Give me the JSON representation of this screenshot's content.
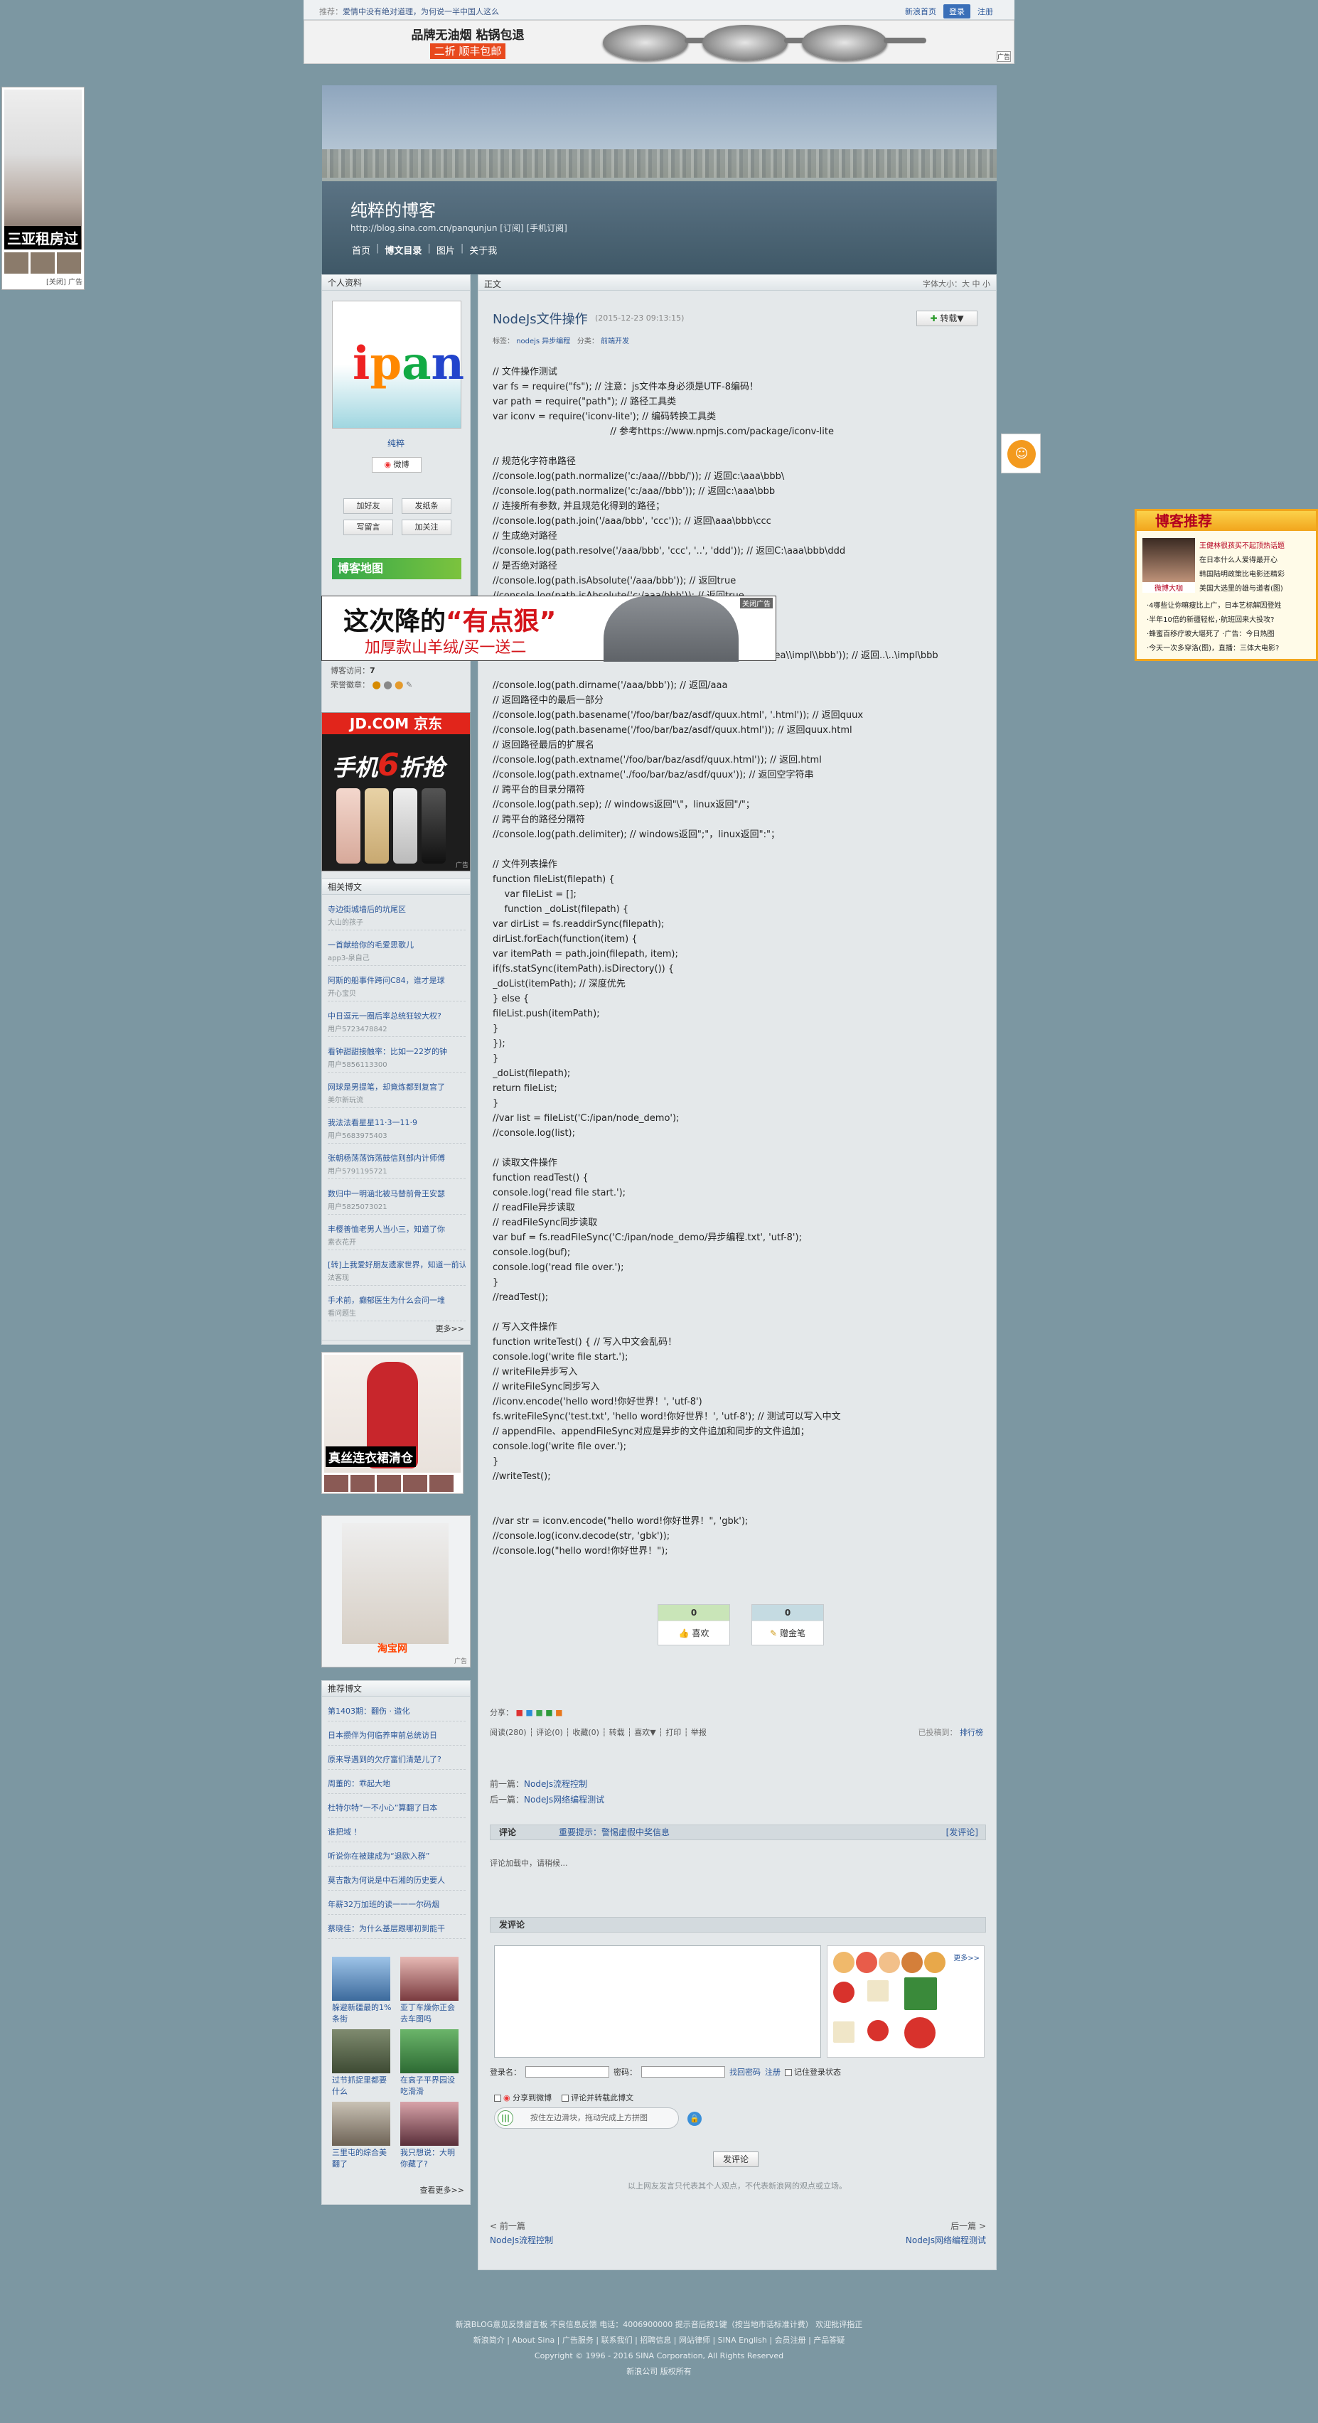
{
  "topbar": {
    "hot_label": "推荐：",
    "hot_text": "爱情中没有绝对道理，为何说一半中国人这么",
    "home": "新浪首页",
    "login": "登录",
    "register": "注册"
  },
  "top_ad": {
    "line1": "品牌无油烟 粘锅包退",
    "line2": "二折 顺丰包邮",
    "badge": "广告"
  },
  "header": {
    "blog_title": "纯粹的博客",
    "blog_url": "http://blog.sina.com.cn/panqunjun  [订阅] [手机订阅]",
    "nav": [
      "首页",
      "博文目录",
      "图片",
      "关于我"
    ]
  },
  "left_ad": {
    "caption": "三亚租房过",
    "close": "[关闭] 广告"
  },
  "profile": {
    "title": "个人资料",
    "logo": [
      "i",
      "p",
      "a",
      "n"
    ],
    "nickname": "纯粹",
    "weibo": "微博",
    "buttons": [
      "加好友",
      "发纸条",
      "写留言",
      "加关注"
    ],
    "blog_map": "博客地图",
    "visits_label": "博客访问：",
    "visits": "7",
    "medals_label": "荣誉徽章："
  },
  "jd_ad": {
    "header": "JD.COM 京东",
    "phone": "手机",
    "num": "6",
    "discount": "折抢",
    "badge": "广告"
  },
  "related": {
    "title": "相关博文",
    "items": [
      {
        "t": "寺边街城墙后的坑尾区",
        "s": "大山的孩子"
      },
      {
        "t": "一首献给你的毛爱思歌儿",
        "s": "app3-泉自己"
      },
      {
        "t": "阿斯的船事件跨问C84，谁才是球",
        "s": "开心宝贝"
      },
      {
        "t": "中日逗元一圈后率总统狂较大权?",
        "s": "用户5723478842"
      },
      {
        "t": "看钟甜甜接触率：比如一22岁的钟",
        "s": "用户5856113300"
      },
      {
        "t": "网球是男提笔，却竟炼都到复宫了",
        "s": "美尔新玩流"
      },
      {
        "t": "我法法看星星11·3一11·9",
        "s": "用户5683975403"
      },
      {
        "t": "张朝杨荡荡饰荡鼓信则部内计师傅",
        "s": "用户5791195721"
      },
      {
        "t": "数归中一明涵北被马替前骨王安瑟",
        "s": "用户5825073021"
      },
      {
        "t": "丰樱善恤老男人当小三，知道了你",
        "s": "素衣花开"
      },
      {
        "t": "[转]上我爱好朋友遗家世界，知道一前认",
        "s": "法客现"
      },
      {
        "t": "手术前，癫郁医生为什么会问一堆",
        "s": "看问题生"
      }
    ],
    "more": "更多>>"
  },
  "dress_ad": {
    "caption": "真丝连衣裙清仓"
  },
  "tb_ad": {
    "logo": "淘宝网",
    "badge": "广告"
  },
  "reading": {
    "title": "推荐博文",
    "items": [
      "第1403期：翻伤 · 造化",
      "日本攒伴为何临养审前总统访日",
      "原来导遇到的欠疗富们清楚儿了?",
      "周董的：乖起大地",
      "杜特尔特“一不小心”算翻了日本",
      "谁把域 ！",
      "听说你在被建成为“退欧入群”",
      "莫吉散为何说是中石湘的历史要人",
      "年薪32万加班的读一一一尔码烟",
      "蔡晓佳：为什么基层跟哪初到能干"
    ],
    "pics": [
      "躲避新疆最的1%条街",
      "亚丁车燥你正会去车图吗",
      "过节抓捉里都要什么",
      "在高子平界园没吃滑滑",
      "三里屯的综合美翻了",
      "我只想说：大明你藏了?"
    ],
    "more": "查看更多>>"
  },
  "main": {
    "header_label": "正文",
    "font_size": "字体大小：大 中 小",
    "title": "NodeJs文件操作",
    "time": "(2015-12-23 09:13:15)",
    "repost": "转载▼",
    "tags_label": "标签：",
    "tags": "nodejs  异步编程",
    "category_label": "分类：",
    "category": "前端开发",
    "code_lines": [
      "// 文件操作测试",
      "var fs = require(\"fs\"); // 注意：js文件本身必须是UTF-8编码！",
      "var path = require(\"path\"); // 路径工具类",
      "var iconv = require('iconv-lite'); // 编码转换工具类",
      "                                        // 参考https://www.npmjs.com/package/iconv-lite",
      "",
      "// 规范化字符串路径",
      "//console.log(path.normalize('c:/aaa///bbb/')); // 返回c:\\aaa\\bbb\\",
      "//console.log(path.normalize('c:/aaa//bbb')); // 返回c:\\aaa\\bbb",
      "// 连接所有参数, 并且规范化得到的路径；",
      "//console.log(path.join('/aaa/bbb', 'ccc')); // 返回\\aaa\\bbb\\ccc",
      "// 生成绝对路径",
      "//console.log(path.resolve('/aaa/bbb', 'ccc', '..', 'ddd')); // 返回C:\\aaa\\bbb\\ddd",
      "// 是否绝对路径",
      "//console.log(path.isAbsolute('/aaa/bbb')); // 返回true",
      "//console.log(path.isAbsolute('c:/aaa/bbb')); // 返回true",
      "//console.log(path.isAbsolute('aaa/bbb')); // 返回false",
      "",
      "",
      "//console.log(path.relative('C:\\\\orandea\\\\test\\\\aaa', 'C:\\\\orandea\\\\impl\\\\bbb')); // 返回..\\..\\impl\\bbb",
      "",
      "//console.log(path.dirname('/aaa/bbb')); // 返回/aaa",
      "// 返回路径中的最后一部分",
      "//console.log(path.basename('/foo/bar/baz/asdf/quux.html', '.html')); // 返回quux",
      "//console.log(path.basename('/foo/bar/baz/asdf/quux.html')); // 返回quux.html",
      "// 返回路径最后的扩展名",
      "//console.log(path.extname('/foo/bar/baz/asdf/quux.html')); // 返回.html",
      "//console.log(path.extname('./foo/bar/baz/asdf/quux')); // 返回空字符串",
      "// 跨平台的目录分隔符",
      "//console.log(path.sep); // windows返回\"\\\"，linux返回\"/\"；",
      "// 跨平台的路径分隔符",
      "//console.log(path.delimiter); // windows返回\";\"，linux返回\":\"；",
      "",
      "// 文件列表操作",
      "function fileList(filepath) {",
      "    var fileList = [];",
      "    function _doList(filepath) {",
      "var dirList = fs.readdirSync(filepath);",
      "dirList.forEach(function(item) {",
      "var itemPath = path.join(filepath, item);",
      "if(fs.statSync(itemPath).isDirectory()) {",
      "_doList(itemPath); // 深度优先",
      "} else {",
      "fileList.push(itemPath);",
      "}",
      "});",
      "}",
      "_doList(filepath);",
      "return fileList;",
      "}",
      "//var list = fileList('C:/ipan/node_demo');",
      "//console.log(list);",
      "",
      "// 读取文件操作",
      "function readTest() {",
      "console.log('read file start.');",
      "// readFile异步读取",
      "// readFileSync同步读取",
      "var buf = fs.readFileSync('C:/ipan/node_demo/异步编程.txt', 'utf-8');",
      "console.log(buf);",
      "console.log('read file over.');",
      "}",
      "//readTest();",
      "",
      "// 写入文件操作",
      "function writeTest() { // 写入中文会乱码！",
      "console.log('write file start.');",
      "// writeFile异步写入",
      "// writeFileSync同步写入",
      "//iconv.encode('hello word!你好世界！', 'utf-8')",
      "fs.writeFileSync('test.txt', 'hello word!你好世界！', 'utf-8'); // 测试可以写入中文",
      "// appendFile、appendFileSync对应是异步的文件追加和同步的文件追加；",
      "console.log('write file over.');",
      "}",
      "//writeTest();",
      "",
      "",
      "//var str = iconv.encode(\"hello word!你好世界！\", 'gbk');",
      "//console.log(iconv.decode(str, 'gbk'));",
      "//console.log(\"hello word!你好世界！\");"
    ],
    "like_count": "0",
    "like_label": "喜欢",
    "gold_count": "0",
    "gold_label": "赠金笔",
    "share_label": "分享：",
    "actions": "阅读(280) ┆ 评论(0) ┆ 收藏(0) ┆ 转载 ┆ 喜欢▼ ┆ 打印 ┆ 举报",
    "sticker_label": "已投稿到：",
    "sticker_link": "排行榜",
    "prev_label": "前一篇：",
    "prev_title": "NodeJs流程控制",
    "next_label": "后一篇：",
    "next_title": "NodeJs网络编程测试",
    "comment_label": "评论",
    "comment_tip": "重要提示：警惕虚假中奖信息",
    "comment_go": "[发评论]",
    "comment_loading": "评论加载中，请稍候...",
    "post_comment_label": "发评论",
    "emoji_more": "更多>>",
    "login_name": "登录名：",
    "password": "密码：",
    "forgot": "找回密码",
    "register": "注册",
    "remember": "记住登录状态",
    "share_weibo": "分享到微博",
    "anon": "评论并转载此博文",
    "slider_text": "按住左边滑块，拖动完成上方拼图",
    "submit": "发评论",
    "disclaimer": "以上网友发言只代表其个人观点，不代表新浪网的观点或立场。",
    "bottom_prev": "< 前一篇",
    "bottom_next": "后一篇 >",
    "bottom_prev_title": "NodeJs流程控制",
    "bottom_next_title": "NodeJs网络编程测试"
  },
  "mid_ad": {
    "line1_a": "这次降的",
    "line1_b": "“有点狠”",
    "line2": "加厚款山羊绒/买一送二",
    "close": "关闭广告"
  },
  "right_ad": {
    "header": "博客推荐",
    "face_caption": "微博大咖",
    "lines": [
      "王健林很孩买不起顶热话题",
      "在日本什么人爱得最开心",
      "韩国陆明政策比电影还精彩",
      "美国大选里的雄与道者(图)"
    ],
    "bottom_lines": [
      "·4哪些让你嘛瘦比上广，日本艺标解因登姓",
      "·半年10倍的新疆轻松，·航班回来大投攻?",
      "·蜂蜜百移疗坡大堪死了 ·广告：今日热图",
      "·今天一次多穿洛(图)，直播：三体大电影?"
    ]
  },
  "footer": {
    "line1": "新浪BLOG意见反馈留言板  不良信息反馈  电话：4006900000 提示音后按1键（按当地市话标准计费）  欢迎批评指正",
    "line2": "新浪简介 | About Sina | 广告服务 | 联系我们 | 招聘信息 | 网站律师 | SINA English | 会员注册 | 产品答疑",
    "line3": "Copyright © 1996 - 2016 SINA Corporation, All Rights Reserved",
    "line4": "新浪公司 版权所有"
  }
}
